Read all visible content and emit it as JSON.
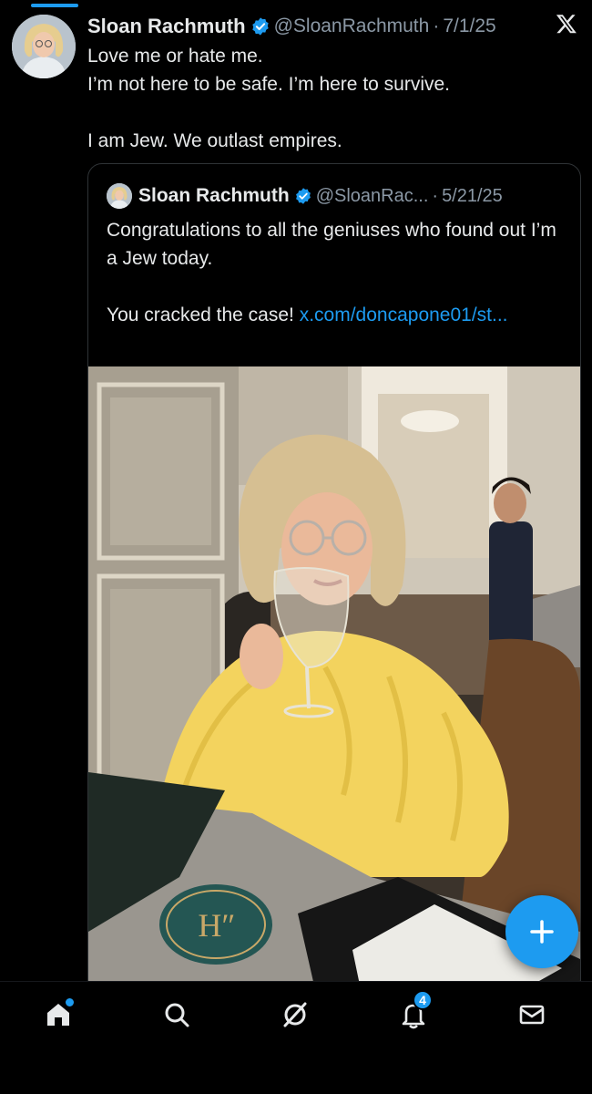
{
  "tweet": {
    "author_name": "Sloan Rachmuth",
    "handle": "@SloanRachmuth",
    "separator": "·",
    "date": "7/1/25",
    "lines": [
      "Love me or hate me.",
      "I’m not here to be safe. I’m here to survive."
    ],
    "closing_line": "I am Jew. We outlast empires."
  },
  "quoted_tweet": {
    "author_name": "Sloan Rachmuth",
    "handle": "@SloanRac...",
    "separator": "·",
    "date": "5/21/25",
    "line1": "Congratulations to all the geniuses who found out I’m a Jew today.",
    "line2": "You cracked the case!",
    "link_text": "x.com/doncapone01/st..."
  },
  "coaster_text": "Hʺ",
  "icons": {
    "verified": "verified-badge-icon",
    "brand": "x-logo-icon",
    "compose": "plus-icon",
    "nav": [
      "home-icon",
      "search-icon",
      "grok-icon",
      "notifications-icon",
      "messages-icon"
    ]
  },
  "bottom_nav": {
    "notifications_count": "4"
  },
  "colors": {
    "accent": "#1d9bf0",
    "background": "#000000",
    "text": "#e7e9ea",
    "secondary_text": "#8b98a5"
  }
}
